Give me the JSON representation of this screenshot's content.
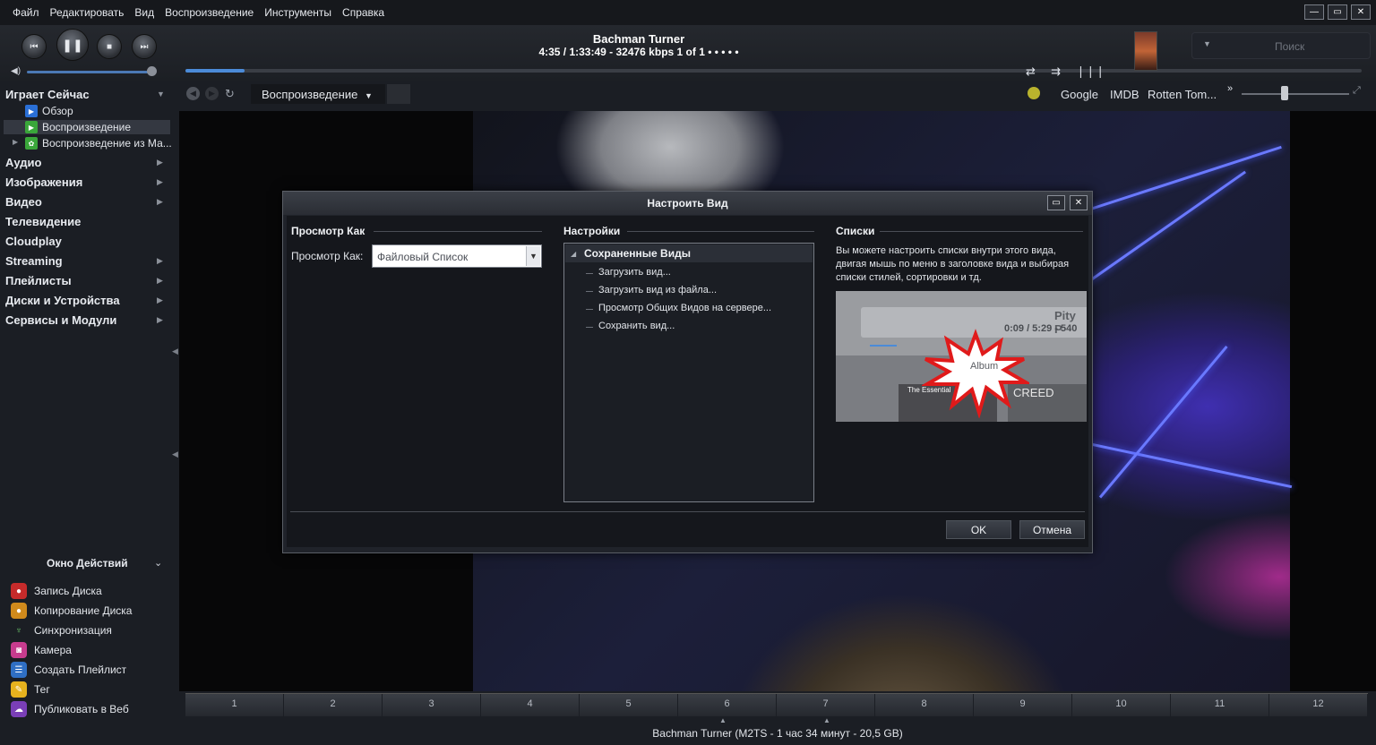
{
  "menu": [
    "Файл",
    "Редактировать",
    "Вид",
    "Воспроизведение",
    "Инструменты",
    "Справка"
  ],
  "now_playing": {
    "title": "Bachman Turner",
    "info": "4:35 / 1:33:49 - 32476 kbps   1 of 1   •  •  •  •  •",
    "progress_percent": 5
  },
  "search": {
    "placeholder": "Поиск"
  },
  "nav": {
    "view_tab": "Воспроизведение",
    "links": [
      "Google",
      "IMDB",
      "Rotten Tom..."
    ]
  },
  "sidebar": {
    "playing_now": "Играет Сейчас",
    "sub_items": [
      "Обзор",
      "Воспроизведение",
      "Воспроизведение из Ма..."
    ],
    "sections": [
      "Аудио",
      "Изображения",
      "Видео",
      "Телевидение",
      "Cloudplay",
      "Streaming",
      "Плейлисты",
      "Диски и Устройства",
      "Сервисы и Модули"
    ]
  },
  "action_window": {
    "title": "Окно Действий",
    "items": [
      "Запись Диска",
      "Копирование Диска",
      "Синхронизация",
      "Камера",
      "Создать Плейлист",
      "Тег",
      "Публиковать в Веб"
    ]
  },
  "chapters": [
    "1",
    "2",
    "3",
    "4",
    "5",
    "6",
    "7",
    "8",
    "9",
    "10",
    "11",
    "12"
  ],
  "footer": "Bachman Turner (M2TS - 1 час 34 минут - 20,5 GB)",
  "dialog": {
    "title": "Настроить Вид",
    "view_as_header": "Просмотр Как",
    "view_as_label": "Просмотр Как:",
    "view_as_value": "Файловый Список",
    "settings_header": "Настройки",
    "saved_views": "Сохраненные Виды",
    "tree_items": [
      "Загрузить вид...",
      "Загрузить вид из файла...",
      "Просмотр Общих Видов на сервере...",
      "Сохранить вид..."
    ],
    "lists_header": "Списки",
    "lists_text": "Вы можете настроить списки внутри этого вида, двигая мышь по меню в заголовке вида и выбирая списки стилей, сортировки и тд.",
    "preview": {
      "title": "Pity P",
      "info": "0:09 / 5:29 - 540",
      "menu_label": "Album",
      "album_1": "The Essential",
      "album_2": "CREED"
    },
    "ok": "OK",
    "cancel": "Отмена"
  }
}
